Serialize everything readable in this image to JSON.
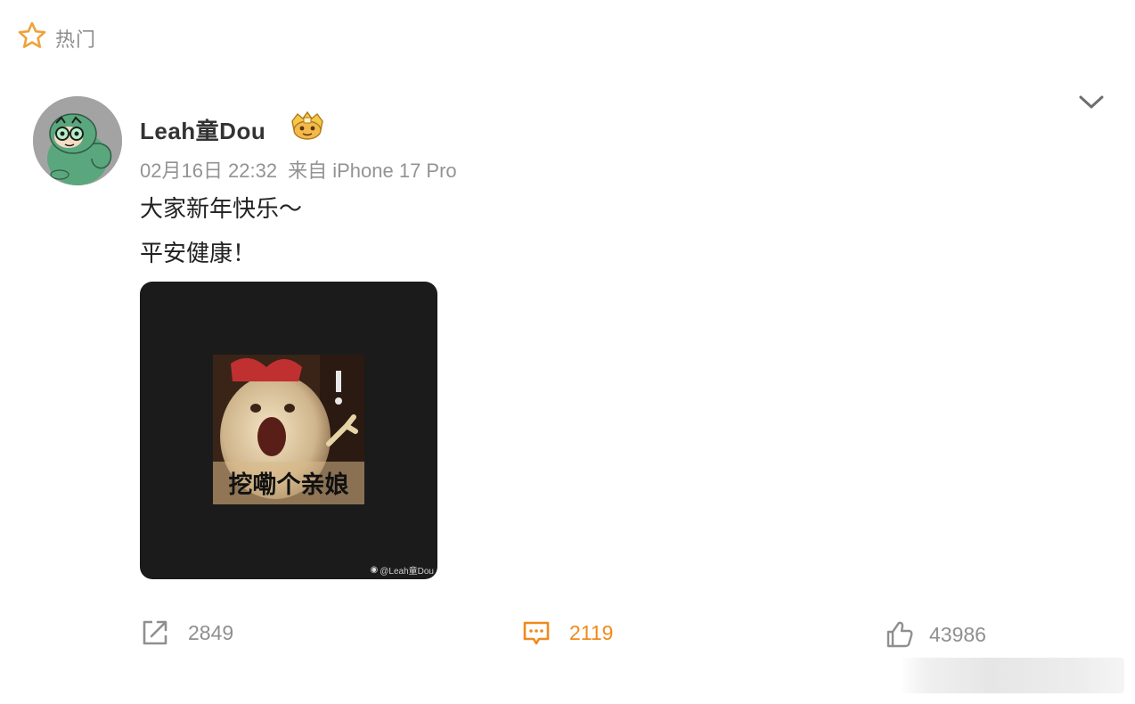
{
  "feed": {
    "section_label": "热门"
  },
  "post": {
    "author": "Leah童Dou",
    "timestamp": "02月16日 22:32",
    "source": "来自 iPhone 17 Pro",
    "lines": [
      "大家新年快乐～",
      "平安健康！"
    ],
    "image": {
      "caption": "挖嘞个亲娘",
      "watermark": "@Leah童Dou"
    },
    "actions": {
      "repost_count": "2849",
      "comment_count": "2119",
      "like_count": "43986"
    }
  },
  "colors": {
    "accent_orange": "#f08a1c",
    "muted_gray": "#8f8f8f",
    "text_dark": "#222222",
    "media_bg": "#1b1b1b"
  },
  "icons": [
    "star-icon",
    "chevron-down-icon",
    "vip-badge-icon",
    "repost-icon",
    "comment-icon",
    "like-icon",
    "weibo-logo-icon"
  ]
}
